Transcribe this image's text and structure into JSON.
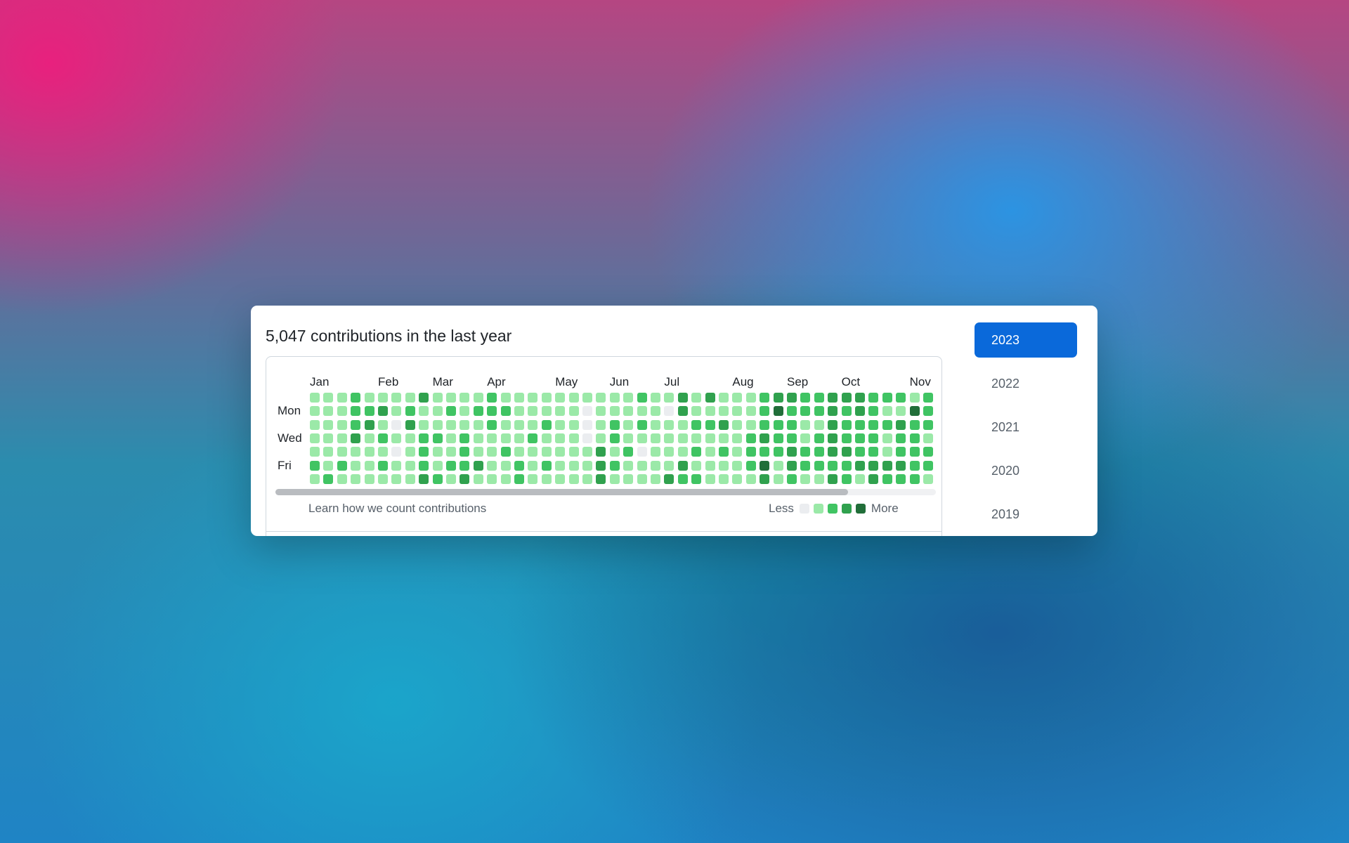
{
  "header": {
    "title": "5,047 contributions in the last year"
  },
  "graph": {
    "months": [
      {
        "label": "Jan",
        "col": 0
      },
      {
        "label": "Feb",
        "col": 5
      },
      {
        "label": "Mar",
        "col": 9
      },
      {
        "label": "Apr",
        "col": 13
      },
      {
        "label": "May",
        "col": 18
      },
      {
        "label": "Jun",
        "col": 22
      },
      {
        "label": "Jul",
        "col": 26
      },
      {
        "label": "Aug",
        "col": 31
      },
      {
        "label": "Sep",
        "col": 35
      },
      {
        "label": "Oct",
        "col": 39
      },
      {
        "label": "Nov",
        "col": 44
      }
    ],
    "days": [
      {
        "label": "Mon",
        "row": 1
      },
      {
        "label": "Wed",
        "row": 3
      },
      {
        "label": "Fri",
        "row": 5
      }
    ],
    "levels": [
      [
        1,
        1,
        1,
        2,
        1,
        1,
        1,
        1,
        3,
        1,
        1,
        1,
        1,
        2,
        1,
        1,
        1,
        1,
        1,
        1,
        1,
        1,
        1,
        1,
        2,
        1,
        1,
        3,
        1,
        3,
        1,
        1,
        1,
        2,
        3,
        3,
        2,
        2,
        3,
        3,
        3,
        2,
        2,
        2,
        1,
        2
      ],
      [
        1,
        1,
        1,
        2,
        2,
        3,
        1,
        2,
        1,
        1,
        2,
        1,
        2,
        2,
        2,
        1,
        1,
        1,
        1,
        1,
        0,
        1,
        1,
        1,
        1,
        1,
        0,
        3,
        1,
        1,
        1,
        1,
        1,
        2,
        4,
        2,
        2,
        2,
        3,
        2,
        3,
        2,
        1,
        1,
        4,
        2
      ],
      [
        1,
        1,
        1,
        2,
        3,
        1,
        0,
        3,
        1,
        1,
        1,
        1,
        1,
        2,
        1,
        1,
        1,
        2,
        1,
        1,
        0,
        1,
        2,
        1,
        2,
        1,
        1,
        1,
        2,
        2,
        3,
        1,
        1,
        2,
        2,
        2,
        1,
        1,
        3,
        2,
        2,
        2,
        2,
        3,
        2,
        2
      ],
      [
        1,
        1,
        1,
        3,
        1,
        2,
        1,
        1,
        2,
        2,
        1,
        2,
        1,
        1,
        1,
        1,
        2,
        1,
        1,
        1,
        0,
        1,
        2,
        1,
        1,
        1,
        1,
        1,
        1,
        1,
        1,
        1,
        2,
        3,
        2,
        2,
        1,
        2,
        3,
        2,
        2,
        2,
        1,
        2,
        2,
        1
      ],
      [
        1,
        1,
        1,
        1,
        1,
        1,
        0,
        1,
        2,
        1,
        1,
        2,
        1,
        1,
        2,
        1,
        1,
        1,
        1,
        1,
        1,
        3,
        1,
        2,
        0,
        1,
        1,
        1,
        2,
        1,
        2,
        1,
        2,
        2,
        2,
        3,
        2,
        2,
        3,
        3,
        2,
        2,
        1,
        2,
        2,
        2
      ],
      [
        2,
        1,
        2,
        1,
        1,
        2,
        1,
        1,
        2,
        1,
        2,
        2,
        3,
        1,
        1,
        2,
        1,
        2,
        1,
        1,
        1,
        3,
        2,
        1,
        1,
        1,
        1,
        3,
        1,
        1,
        1,
        1,
        2,
        4,
        1,
        3,
        2,
        2,
        2,
        2,
        3,
        3,
        3,
        3,
        2,
        2
      ],
      [
        1,
        2,
        1,
        1,
        1,
        1,
        1,
        1,
        3,
        2,
        1,
        3,
        1,
        1,
        1,
        2,
        1,
        1,
        1,
        1,
        1,
        3,
        1,
        1,
        1,
        1,
        3,
        2,
        2,
        1,
        1,
        1,
        1,
        3,
        1,
        2,
        1,
        1,
        3,
        2,
        1,
        3,
        2,
        2,
        2,
        1
      ]
    ],
    "level_colors": [
      "#ebedf0",
      "#9be9a8",
      "#40c463",
      "#30a14e",
      "#216e39"
    ],
    "learn_link": "Learn how we count contributions",
    "legend_less": "Less",
    "legend_more": "More"
  },
  "years": [
    {
      "label": "2023",
      "active": true
    },
    {
      "label": "2022",
      "active": false
    },
    {
      "label": "2021",
      "active": false
    },
    {
      "label": "2020",
      "active": false
    },
    {
      "label": "2019",
      "active": false
    }
  ],
  "colors": {
    "accent": "#0a69da"
  }
}
